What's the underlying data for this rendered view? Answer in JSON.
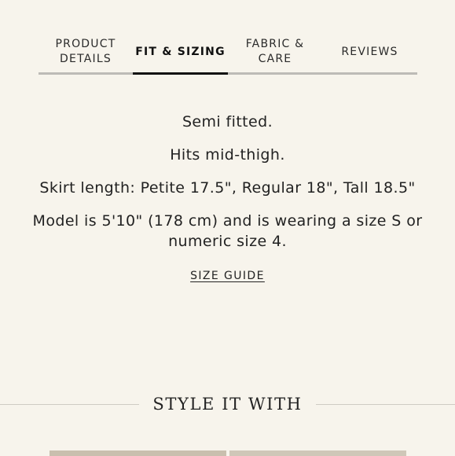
{
  "tabs": [
    {
      "label": "PRODUCT\nDETAILS",
      "active": false
    },
    {
      "label": "FIT & SIZING",
      "active": true
    },
    {
      "label": "FABRIC &\nCARE",
      "active": false
    },
    {
      "label": "REVIEWS",
      "active": false
    }
  ],
  "fit": {
    "lines": [
      "Semi fitted.",
      "Hits mid-thigh.",
      "Skirt length: Petite 17.5\", Regular 18\", Tall 18.5\"",
      "Model is 5'10\" (178 cm) and is wearing a size S or numeric size 4."
    ],
    "size_guide_label": "SIZE GUIDE"
  },
  "style_section": {
    "title": "STYLE IT WITH"
  },
  "colors": {
    "background": "#f7f4ec",
    "tab_underline": "#bdbbb6",
    "active_underline": "#111111"
  }
}
